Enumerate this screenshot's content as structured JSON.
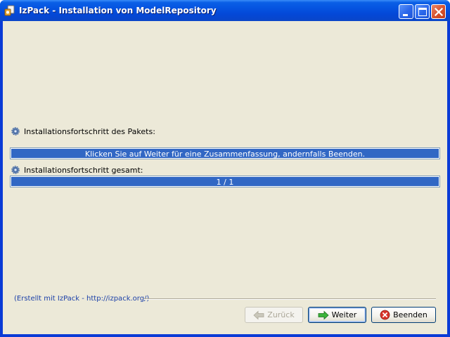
{
  "window": {
    "title": "IzPack - Installation von ModelRepository"
  },
  "pack_progress": {
    "label": "Installationsfortschritt des Pakets:",
    "fraction": 1.0,
    "text": "Klicken Sie auf Weiter für eine Zusammenfassung, andernfalls Beenden."
  },
  "overall_progress": {
    "label": "Installationsfortschritt gesamt:",
    "fraction": 1.0,
    "text": "1 / 1"
  },
  "footer": {
    "credits": "(Erstellt mit IzPack - http://izpack.org/)"
  },
  "buttons": {
    "back": "Zurück",
    "next": "Weiter",
    "quit": "Beenden"
  },
  "colors": {
    "progress_fill": "#3167c4",
    "client_background": "#ece9d8",
    "titlebar_blue": "#0553e0"
  },
  "icons": {
    "app": "izpack-app-icon",
    "progress": "gear-icon",
    "back": "back-arrow-icon",
    "next": "next-arrow-icon",
    "quit": "quit-icon"
  }
}
